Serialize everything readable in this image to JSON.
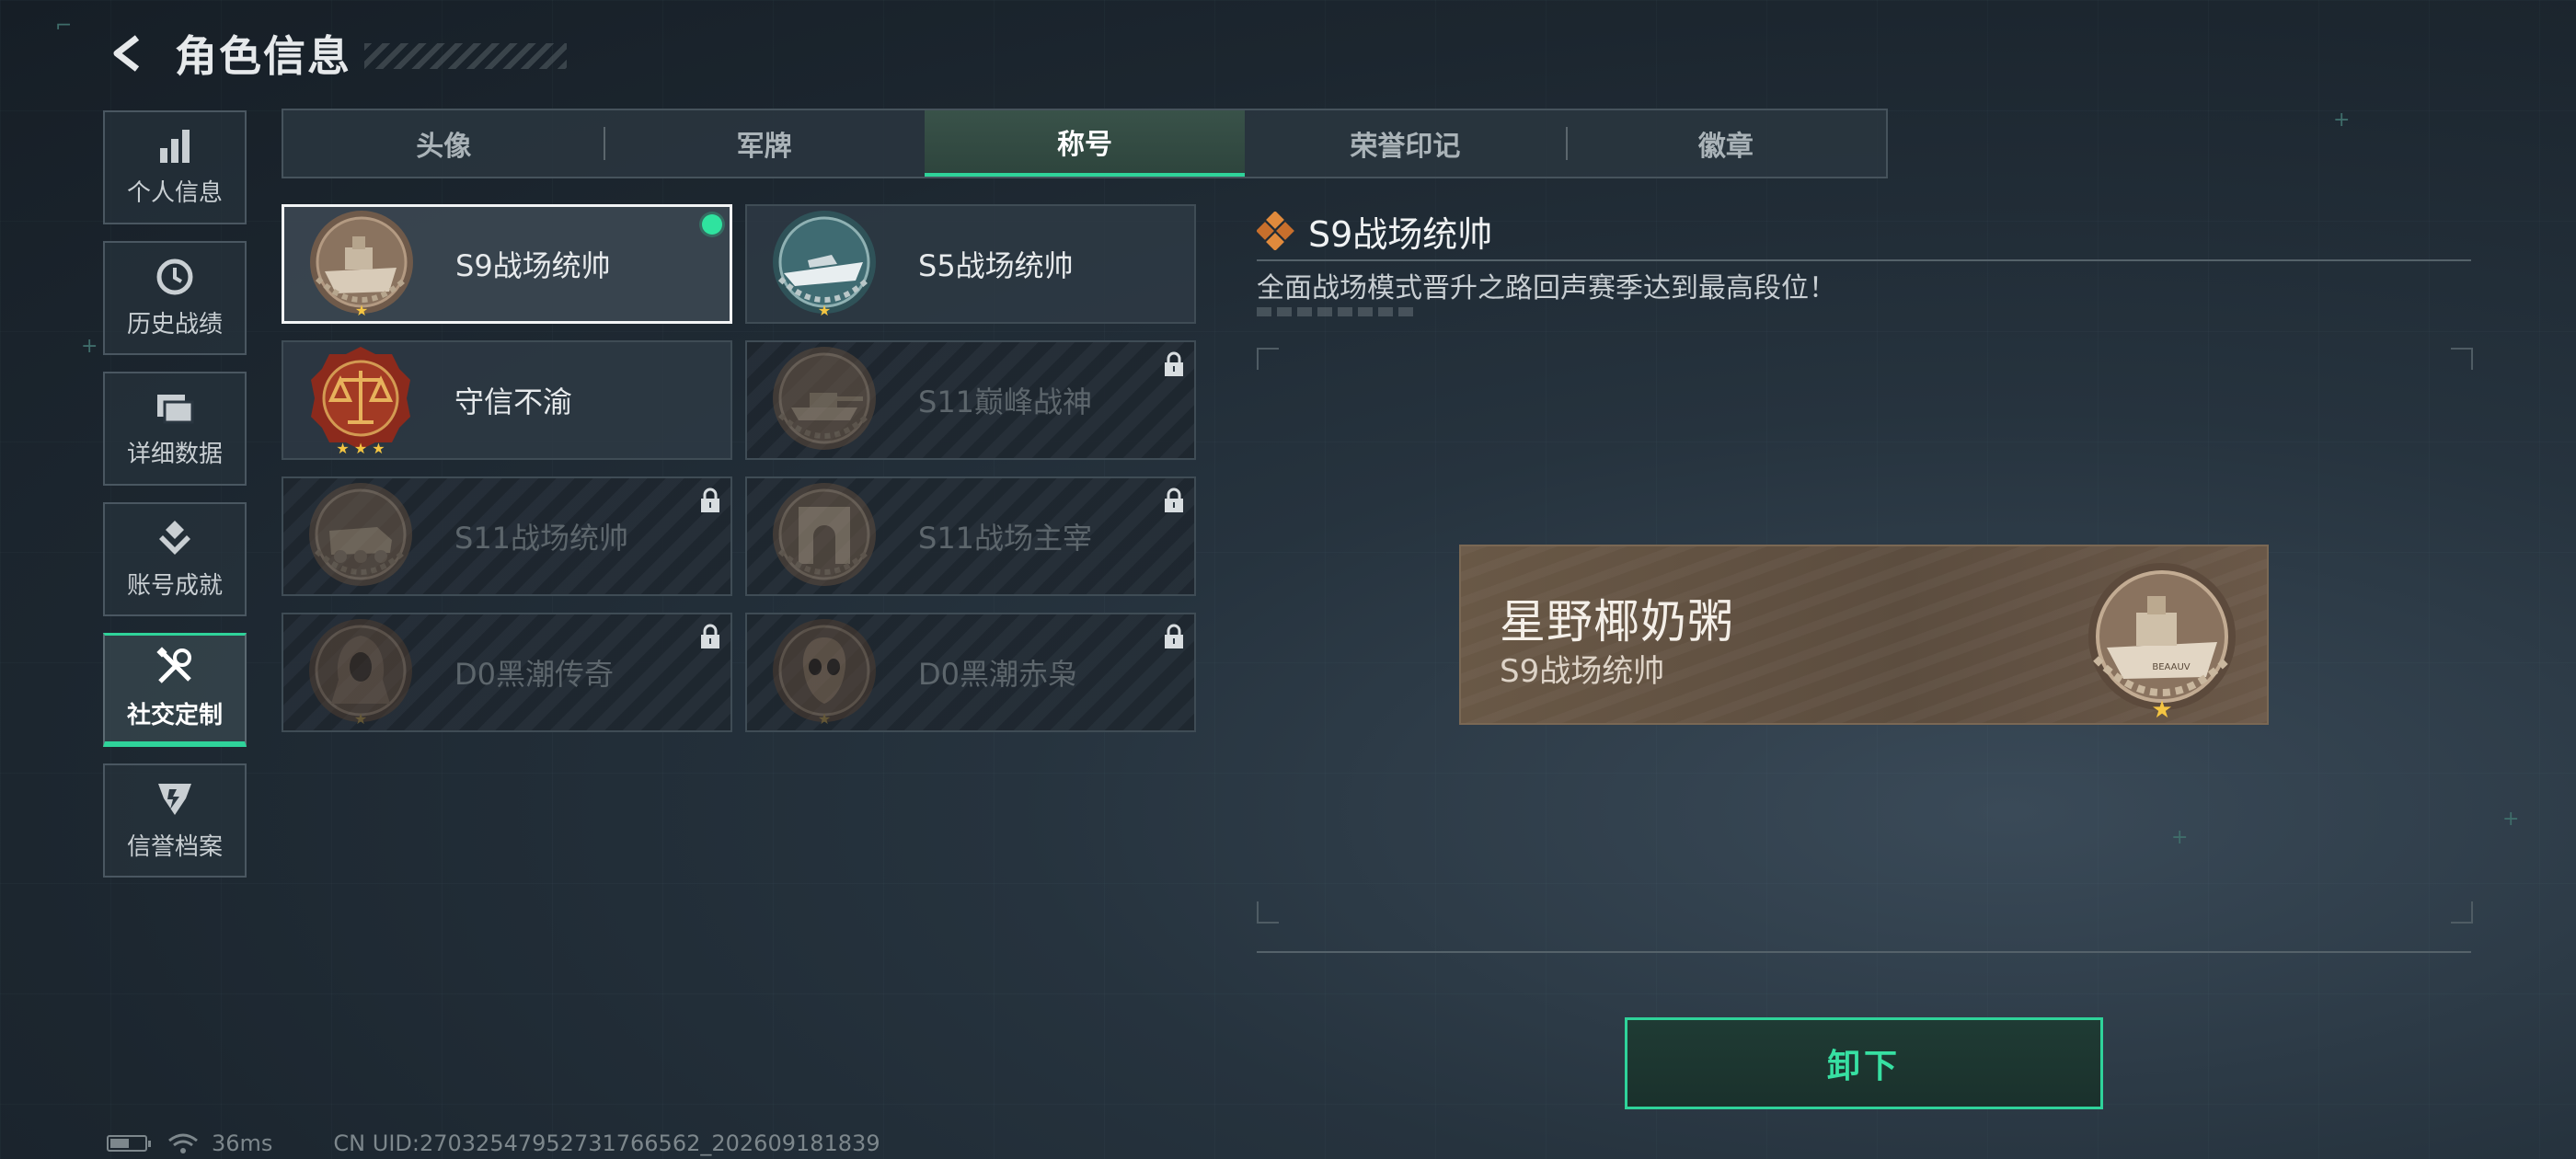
{
  "header": {
    "title": "角色信息"
  },
  "sidenav": {
    "items": [
      {
        "label": "个人信息",
        "icon": "bar-chart-icon"
      },
      {
        "label": "历史战绩",
        "icon": "clock-icon"
      },
      {
        "label": "详细数据",
        "icon": "folder-icon"
      },
      {
        "label": "账号成就",
        "icon": "achievement-icon"
      },
      {
        "label": "社交定制",
        "icon": "tools-icon",
        "active": true
      },
      {
        "label": "信誉档案",
        "icon": "shield-icon"
      }
    ]
  },
  "tabs": [
    {
      "label": "头像"
    },
    {
      "label": "军牌"
    },
    {
      "label": "称号",
      "active": true
    },
    {
      "label": "荣誉印记"
    },
    {
      "label": "徽章"
    }
  ],
  "titles": [
    {
      "name": "S9战场统帅",
      "badge": "ship-badge-icon",
      "locked": false,
      "selected": true,
      "equipped": true
    },
    {
      "name": "S5战场统帅",
      "badge": "boat-badge-icon",
      "locked": false
    },
    {
      "name": "守信不渝",
      "badge": "scales-badge-icon",
      "locked": false
    },
    {
      "name": "S11巅峰战神",
      "badge": "tank-badge-icon",
      "locked": true
    },
    {
      "name": "S11战场统帅",
      "badge": "apc-badge-icon",
      "locked": true
    },
    {
      "name": "S11战场主宰",
      "badge": "arch-badge-icon",
      "locked": true
    },
    {
      "name": "D0黑潮传奇",
      "badge": "hooded-figure-badge-icon",
      "locked": true
    },
    {
      "name": "D0黑潮赤枭",
      "badge": "skull-mask-badge-icon",
      "locked": true
    }
  ],
  "detail": {
    "title": "S9战场统帅",
    "description": "全面战场模式晋升之路回声赛季达到最高段位！"
  },
  "preview": {
    "player_name": "星野椰奶粥",
    "title": "S9战场统帅",
    "badge_ship_text": "BEAAUV"
  },
  "unequip": {
    "label": "卸下"
  },
  "status": {
    "ping": "36ms",
    "uid": "CN UID:27032547952731766562_202609181839",
    "battery_level": 0.6
  },
  "colors": {
    "accent": "#2fd39a",
    "equipped": "#2fe39f",
    "selected_border": "#f2f4f5",
    "bronze": "#7a6252"
  }
}
